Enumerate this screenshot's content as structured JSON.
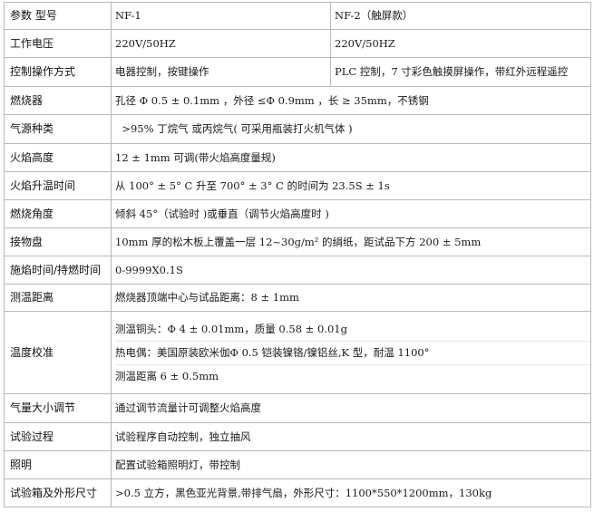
{
  "rows": [
    {
      "label": "参数 型号",
      "col1": "NF-1",
      "col2": "NF-2（触屏款）"
    },
    {
      "label": "工作电压",
      "col1": "220V/50HZ",
      "col2": "220V/50HZ"
    },
    {
      "label": "控制操作方式",
      "col1": "电器控制，按键操作",
      "col2": "PLC 控制，7 寸彩色触摸屏操作，带红外远程遥控"
    },
    {
      "label": "燃烧器",
      "value": "孔径 Φ 0.5 ± 0.1mm ，外径 ≤Φ 0.9mm ，长 ≥ 35mm，不锈钢"
    },
    {
      "label": "气源种类",
      "value": "  >95% 丁烷气 或丙烷气( 可采用瓶装打火机气体 )"
    },
    {
      "label": "火焰高度",
      "value": "12 ± 1mm 可调(带火焰高度量规)"
    },
    {
      "label": "火焰升温时间",
      "value": "从 100°  ± 5° C 升至 700°  ± 3° C 的时间为 23.5S ± 1s"
    },
    {
      "label": "燃烧角度",
      "value": "倾斜  45°（试验时 )或垂直（调节火焰高度时 )"
    },
    {
      "label": "接物盘",
      "value": "10mm 厚的松木板上覆盖一层 12~30g/m² 的绢纸，距试品下方 200 ± 5mm"
    },
    {
      "label": "施焰时间/持燃时间",
      "value": "0-9999X0.1S"
    },
    {
      "label": "测温距离",
      "value": "燃烧器顶端中心与试品距离：8 ± 1mm"
    },
    {
      "label": "温度校准",
      "lines": [
        "测温铜头：Φ 4 ± 0.01mm，质量 0.58 ± 0.01g",
        "热电偶：美国原装欧米伽Φ 0.5  铠装镍铬/镍铝丝,K 型，耐温 1100°",
        "测温距离 6 ± 0.5mm"
      ]
    },
    {
      "label": "气量大小调节",
      "value": "通过调节流量计可调整火焰高度"
    },
    {
      "label": "试验过程",
      "value": "试验程序自动控制，独立抽风"
    },
    {
      "label": "照明",
      "value": "配置试验箱照明灯，带控制"
    },
    {
      "label": "试验箱及外形尺寸",
      "value": ">0.5 立方，黑色亚光背景,带排气扇，外形尺寸：1100*550*1200mm，130kg"
    }
  ]
}
